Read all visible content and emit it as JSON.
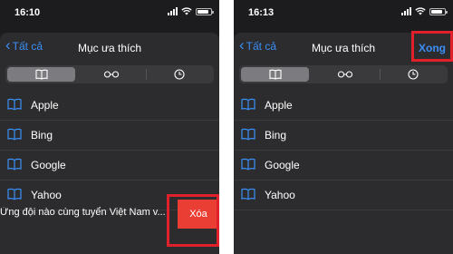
{
  "left": {
    "status": {
      "time": "16:10"
    },
    "nav": {
      "back_label": "Tất cả",
      "title": "Mục ưa thích"
    },
    "items": [
      {
        "label": "Apple"
      },
      {
        "label": "Bing"
      },
      {
        "label": "Google"
      },
      {
        "label": "Yahoo"
      }
    ],
    "swiped_item": {
      "label": "Ừng đội nào cùng tuyển Việt Nam v..."
    },
    "delete_label": "Xóa"
  },
  "right": {
    "status": {
      "time": "16:13"
    },
    "nav": {
      "back_label": "Tất cả",
      "title": "Mục ưa thích",
      "done_label": "Xong"
    },
    "items": [
      {
        "label": "Apple"
      },
      {
        "label": "Bing"
      },
      {
        "label": "Google"
      },
      {
        "label": "Yahoo"
      }
    ]
  },
  "segments": [
    {
      "icon": "book-icon",
      "active": true
    },
    {
      "icon": "reading-list-glasses-icon",
      "active": false
    },
    {
      "icon": "history-clock-icon",
      "active": false
    }
  ],
  "colors": {
    "accent": "#3a8ff7",
    "highlight": "#e0202a",
    "delete": "#ea3e35",
    "background": "#1c1c1e",
    "sheet": "#2c2c2e"
  }
}
